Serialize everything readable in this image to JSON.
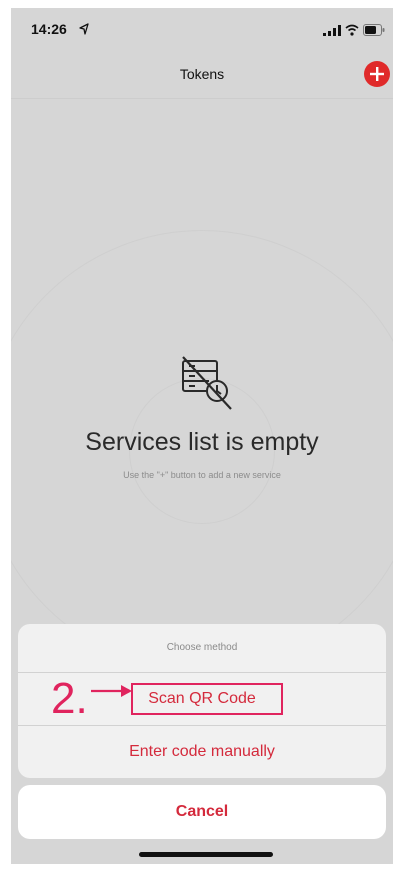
{
  "status_bar": {
    "time": "14:26",
    "location_icon": "location-arrow-icon",
    "signal_icon": "cellular-signal-icon",
    "wifi_icon": "wifi-icon",
    "battery_icon": "battery-icon"
  },
  "nav": {
    "title": "Tokens",
    "add_icon": "plus-circle-icon"
  },
  "empty_state": {
    "icon": "no-services-icon",
    "title": "Services list is empty",
    "hint": "Use the \"+\" button to add a new service"
  },
  "action_sheet": {
    "header": "Choose method",
    "options": [
      {
        "label": "Scan QR Code"
      },
      {
        "label": "Enter code manually"
      }
    ],
    "cancel_label": "Cancel"
  },
  "annotation": {
    "step_label": "2.",
    "highlight_color": "#e0245e"
  },
  "colors": {
    "accent": "#e02a2a",
    "action_text": "#d42a3c",
    "overlay_background": "#d6d6d6"
  }
}
